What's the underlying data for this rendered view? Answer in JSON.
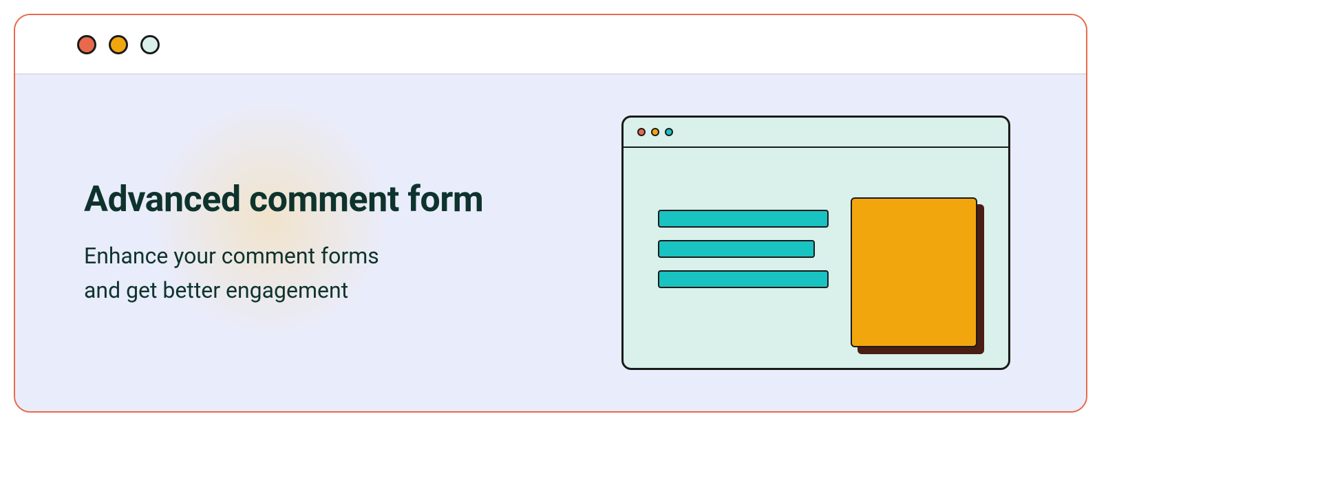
{
  "hero": {
    "heading": "Advanced comment form",
    "subheading_line1": "Enhance your comment forms",
    "subheading_line2": "and get better engagement"
  }
}
